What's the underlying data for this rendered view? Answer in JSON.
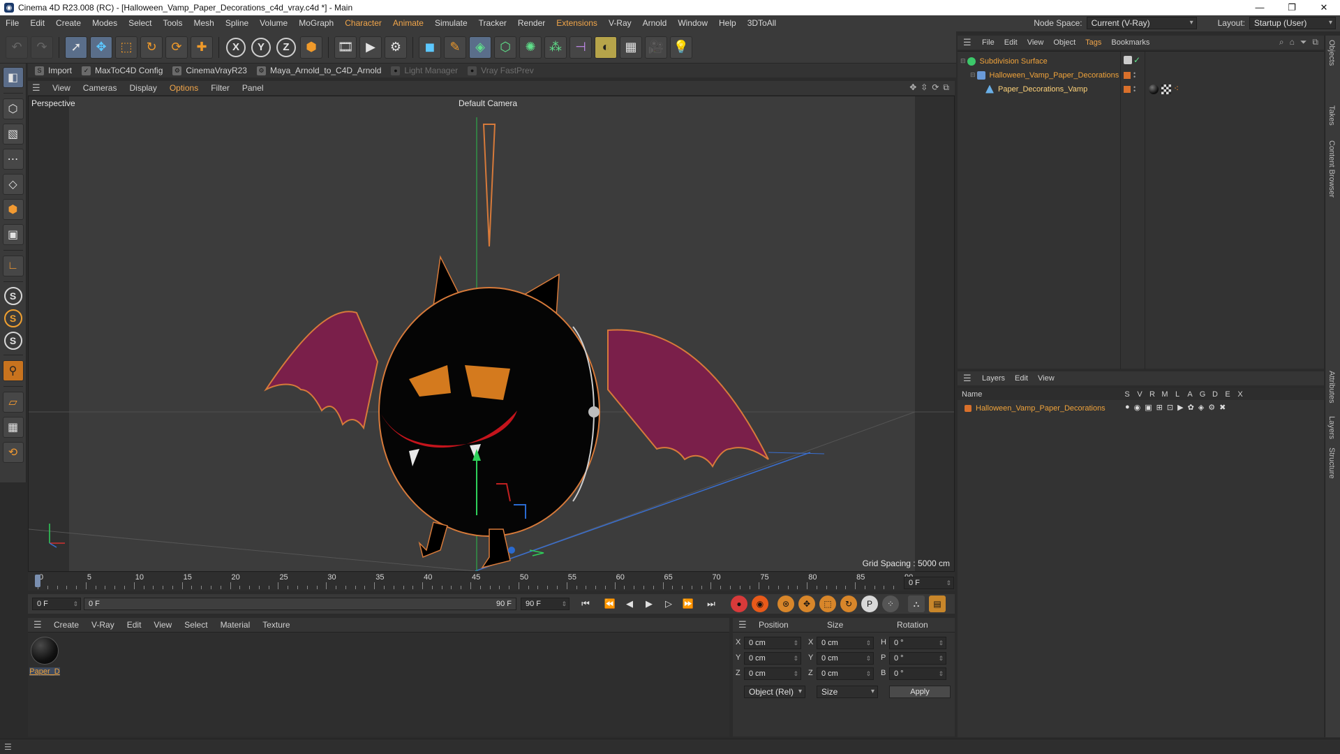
{
  "window": {
    "title": "Cinema 4D R23.008 (RC) - [Halloween_Vamp_Paper_Decorations_c4d_vray.c4d *] - Main",
    "minimize": "—",
    "restore": "❐",
    "close": "✕"
  },
  "menubar": {
    "items": [
      "File",
      "Edit",
      "Create",
      "Modes",
      "Select",
      "Tools",
      "Mesh",
      "Spline",
      "Volume",
      "MoGraph",
      "Character",
      "Animate",
      "Simulate",
      "Tracker",
      "Render",
      "Extensions",
      "V-Ray",
      "Arnold",
      "Window",
      "Help",
      "3DToAll"
    ],
    "node_space_label": "Node Space:",
    "node_space_value": "Current (V-Ray)",
    "layout_label": "Layout:",
    "layout_value": "Startup (User)"
  },
  "pluginbar": {
    "items": [
      "Import",
      "MaxToC4D Config",
      "CinemaVrayR23",
      "Maya_Arnold_to_C4D_Arnold",
      "Light Manager",
      "Vray FastPrev"
    ]
  },
  "viewport": {
    "menu": [
      "View",
      "Cameras",
      "Display",
      "Options",
      "Filter",
      "Panel"
    ],
    "label": "Perspective",
    "camera": "Default Camera",
    "grid_spacing": "Grid Spacing : 5000 cm",
    "colors": {
      "background": "#3c3c3c",
      "wing": "#7a1f4a",
      "body": "#050505",
      "outline": "#d77a3a",
      "eyes": "#d47a1e",
      "mouth": "#c4141c"
    }
  },
  "timeline": {
    "ticks": [
      "0",
      "5",
      "10",
      "15",
      "20",
      "25",
      "30",
      "35",
      "40",
      "45",
      "50",
      "55",
      "60",
      "65",
      "70",
      "75",
      "80",
      "85",
      "90"
    ],
    "current_frame": "0 F",
    "start_field": "0 F",
    "range_start": "0 F",
    "range_end": "90 F",
    "end_field": "90 F"
  },
  "materials": {
    "menu": [
      "Create",
      "V-Ray",
      "Edit",
      "View",
      "Select",
      "Material",
      "Texture"
    ],
    "items": [
      {
        "name": "Paper_D"
      }
    ]
  },
  "coordinates": {
    "headers": [
      "Position",
      "Size",
      "Rotation"
    ],
    "rows": [
      {
        "axis": "X",
        "pos": "0 cm",
        "size_axis": "X",
        "size": "0 cm",
        "rot_axis": "H",
        "rot": "0 °"
      },
      {
        "axis": "Y",
        "pos": "0 cm",
        "size_axis": "Y",
        "size": "0 cm",
        "rot_axis": "P",
        "rot": "0 °"
      },
      {
        "axis": "Z",
        "pos": "0 cm",
        "size_axis": "Z",
        "size": "0 cm",
        "rot_axis": "B",
        "rot": "0 °"
      }
    ],
    "mode": "Object (Rel)",
    "size_mode": "Size",
    "apply": "Apply"
  },
  "objects": {
    "menu": [
      "File",
      "Edit",
      "View",
      "Object",
      "Tags",
      "Bookmarks"
    ],
    "rows": [
      {
        "name": "Subdivision Surface"
      },
      {
        "name": "Halloween_Vamp_Paper_Decorations"
      },
      {
        "name": "Paper_Decorations_Vamp"
      }
    ]
  },
  "layers": {
    "menu": [
      "Layers",
      "Edit",
      "View"
    ],
    "columns": [
      "Name",
      "S",
      "V",
      "R",
      "M",
      "L",
      "A",
      "G",
      "D",
      "E",
      "X"
    ],
    "rows": [
      {
        "name": "Halloween_Vamp_Paper_Decorations"
      }
    ]
  },
  "sidetabs": [
    "Objects",
    "Takes",
    "Content Browser",
    "Attributes",
    "Layers",
    "Structure"
  ]
}
